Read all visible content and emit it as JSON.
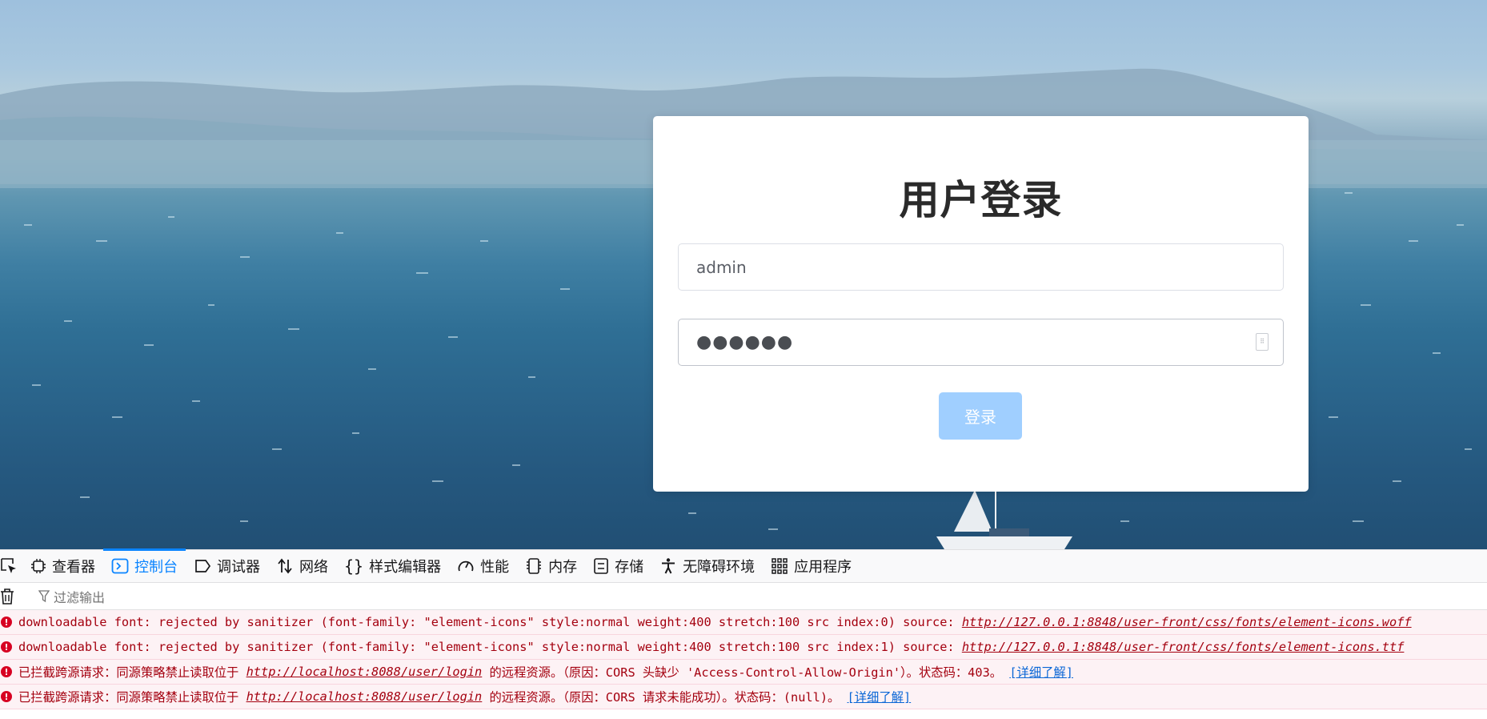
{
  "login": {
    "title": "用户登录",
    "username_value": "admin",
    "password_mask": "●●●●●●",
    "submit_label": "登录",
    "button_color": "#a0cfff"
  },
  "devtools": {
    "tabs": [
      {
        "label": "查看器",
        "icon": "inspector-icon"
      },
      {
        "label": "控制台",
        "icon": "console-icon",
        "active": true
      },
      {
        "label": "调试器",
        "icon": "debugger-icon"
      },
      {
        "label": "网络",
        "icon": "network-icon"
      },
      {
        "label": "样式编辑器",
        "icon": "style-editor-icon"
      },
      {
        "label": "性能",
        "icon": "performance-icon"
      },
      {
        "label": "内存",
        "icon": "memory-icon"
      },
      {
        "label": "存储",
        "icon": "storage-icon"
      },
      {
        "label": "无障碍环境",
        "icon": "accessibility-icon"
      },
      {
        "label": "应用程序",
        "icon": "application-icon"
      }
    ],
    "filter_placeholder": "过滤输出",
    "accent_color": "#0a84ff",
    "messages": [
      {
        "text": "downloadable font: rejected by sanitizer (font-family: \"element-icons\" style:normal weight:400 stretch:100 src index:0) source: ",
        "url": "http://127.0.0.1:8848/user-front/css/fonts/element-icons.woff",
        "suffix": "",
        "more": ""
      },
      {
        "text": "downloadable font: rejected by sanitizer (font-family: \"element-icons\" style:normal weight:400 stretch:100 src index:1) source: ",
        "url": "http://127.0.0.1:8848/user-front/css/fonts/element-icons.ttf",
        "suffix": "",
        "more": ""
      },
      {
        "text": "已拦截跨源请求：同源策略禁止读取位于 ",
        "url": "http://localhost:8088/user/login",
        "suffix": " 的远程资源。（原因：CORS 头缺少 'Access-Control-Allow-Origin'）。状态码：403。 ",
        "more": "[详细了解]"
      },
      {
        "text": "已拦截跨源请求：同源策略禁止读取位于 ",
        "url": "http://localhost:8088/user/login",
        "suffix": " 的远程资源。（原因：CORS 请求未能成功）。状态码：(null)。 ",
        "more": "[详细了解]"
      }
    ]
  }
}
